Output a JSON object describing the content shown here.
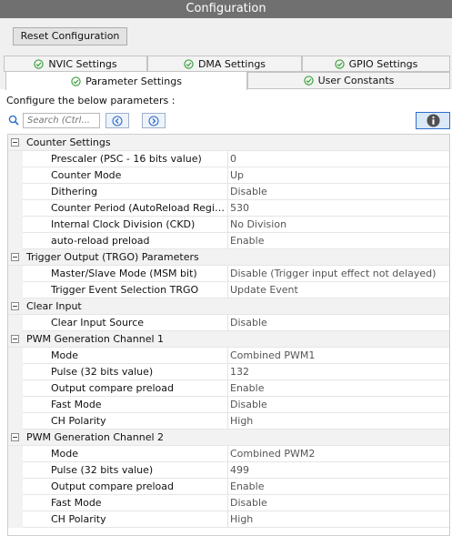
{
  "title": "Configuration",
  "reset_button": "Reset Configuration",
  "tabs_row1": [
    "NVIC Settings",
    "DMA Settings",
    "GPIO Settings"
  ],
  "tabs_row2": [
    "Parameter Settings",
    "User Constants"
  ],
  "configure_label": "Configure the below parameters :",
  "search": {
    "placeholder": "Search (Ctrl..."
  },
  "icons": {
    "search": "search-icon",
    "prev": "arrow-left-icon",
    "next": "arrow-right-icon",
    "info": "info-icon",
    "check": "check-circle-icon",
    "collapse": "collapse-minus-icon"
  },
  "colors": {
    "titlebar": "#707070",
    "check_green": "#3aa13a",
    "info_blue": "#2e6fc9"
  },
  "groups": [
    {
      "name": "Counter Settings",
      "params": [
        {
          "label": "Prescaler (PSC - 16 bits value)",
          "value": "0"
        },
        {
          "label": "Counter Mode",
          "value": "Up"
        },
        {
          "label": "Dithering",
          "value": "Disable"
        },
        {
          "label": "Counter Period (AutoReload Register ...",
          "value": "530"
        },
        {
          "label": "Internal Clock Division (CKD)",
          "value": "No Division"
        },
        {
          "label": "auto-reload preload",
          "value": "Enable"
        }
      ]
    },
    {
      "name": "Trigger Output (TRGO) Parameters",
      "params": [
        {
          "label": "Master/Slave Mode (MSM bit)",
          "value": "Disable (Trigger input effect not delayed)"
        },
        {
          "label": "Trigger Event Selection TRGO",
          "value": "Update Event"
        }
      ]
    },
    {
      "name": "Clear Input",
      "params": [
        {
          "label": "Clear Input Source",
          "value": "Disable"
        }
      ]
    },
    {
      "name": "PWM Generation Channel 1",
      "params": [
        {
          "label": "Mode",
          "value": "Combined PWM1"
        },
        {
          "label": "Pulse (32 bits value)",
          "value": "132"
        },
        {
          "label": "Output compare preload",
          "value": "Enable"
        },
        {
          "label": "Fast Mode",
          "value": "Disable"
        },
        {
          "label": "CH Polarity",
          "value": "High"
        }
      ]
    },
    {
      "name": "PWM Generation Channel 2",
      "params": [
        {
          "label": "Mode",
          "value": "Combined PWM2"
        },
        {
          "label": "Pulse (32 bits value)",
          "value": "499"
        },
        {
          "label": "Output compare preload",
          "value": "Enable"
        },
        {
          "label": "Fast Mode",
          "value": "Disable"
        },
        {
          "label": "CH Polarity",
          "value": "High"
        }
      ]
    }
  ]
}
